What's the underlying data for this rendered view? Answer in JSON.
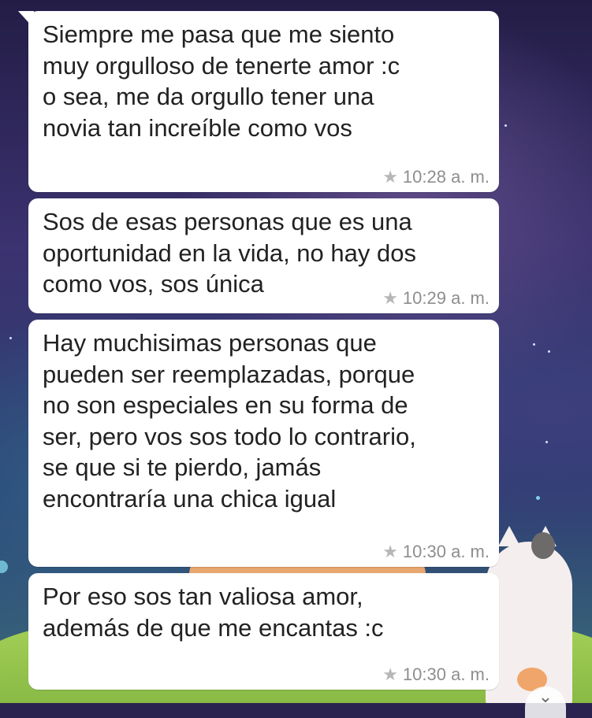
{
  "messages": [
    {
      "text": "Siempre me pasa que me siento\nmuy orgulloso de tenerte amor :c\no sea, me da orgullo tener una\nnovia tan increíble como vos",
      "time": "10:28 a. m.",
      "starred": true
    },
    {
      "text": "Sos de esas personas que es una\noportunidad en la vida, no hay dos\ncomo vos, sos única",
      "time": "10:29 a. m.",
      "starred": true
    },
    {
      "text": "Hay muchisimas personas que\npueden ser reemplazadas, porque\nno son especiales en su forma de\nser, pero vos sos todo lo contrario,\nse que si te pierdo, jamás\nencontraría una chica igual",
      "time": "10:30 a. m.",
      "starred": true
    },
    {
      "text": "Por eso sos tan valiosa amor,\nademás de que me encantas :c",
      "time": "10:30 a. m.",
      "starred": true
    }
  ],
  "icons": {
    "star": "star-icon",
    "scroll_down": "chevron-down-icon"
  },
  "colors": {
    "bubble": "#ffffff",
    "text": "#222222",
    "meta": "#8e8e8e",
    "star": "#b7b7b7"
  }
}
